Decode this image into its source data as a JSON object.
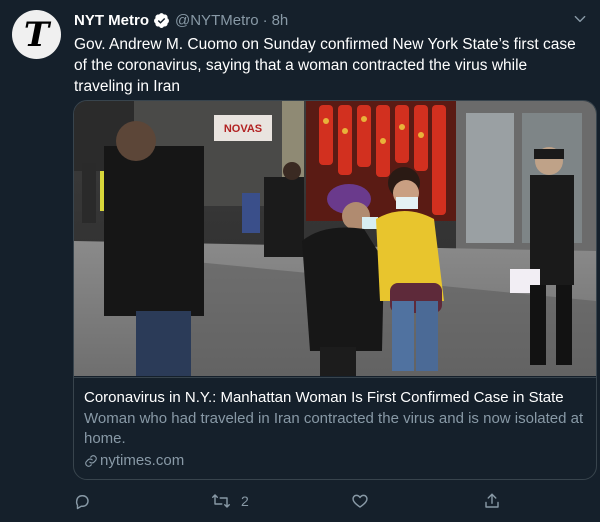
{
  "tweet": {
    "author_name": "NYT Metro",
    "author_handle": "@NYTMetro",
    "separator": "·",
    "time": "8h",
    "avatar_letter": "T",
    "text": "Gov. Andrew M. Cuomo on Sunday confirmed New York State’s first case of the coronavirus, saying that a woman contracted the virus while traveling in Iran"
  },
  "card": {
    "title": "Coronavirus in N.Y.: Manhattan Woman Is First Confirmed Case in State",
    "description": "Woman who had traveled in Iran contracted the virus and is now isolated at home.",
    "domain": "nytimes.com",
    "store_sign": "NOVAS"
  },
  "actions": {
    "reply_icon": "reply-icon",
    "retweet_icon": "retweet-icon",
    "retweet_count": "2",
    "like_icon": "heart-icon",
    "share_icon": "share-icon"
  },
  "colors": {
    "background": "#15202b",
    "border": "#38444d",
    "secondary_text": "#8899a6",
    "verified_badge": "#ffffff"
  }
}
